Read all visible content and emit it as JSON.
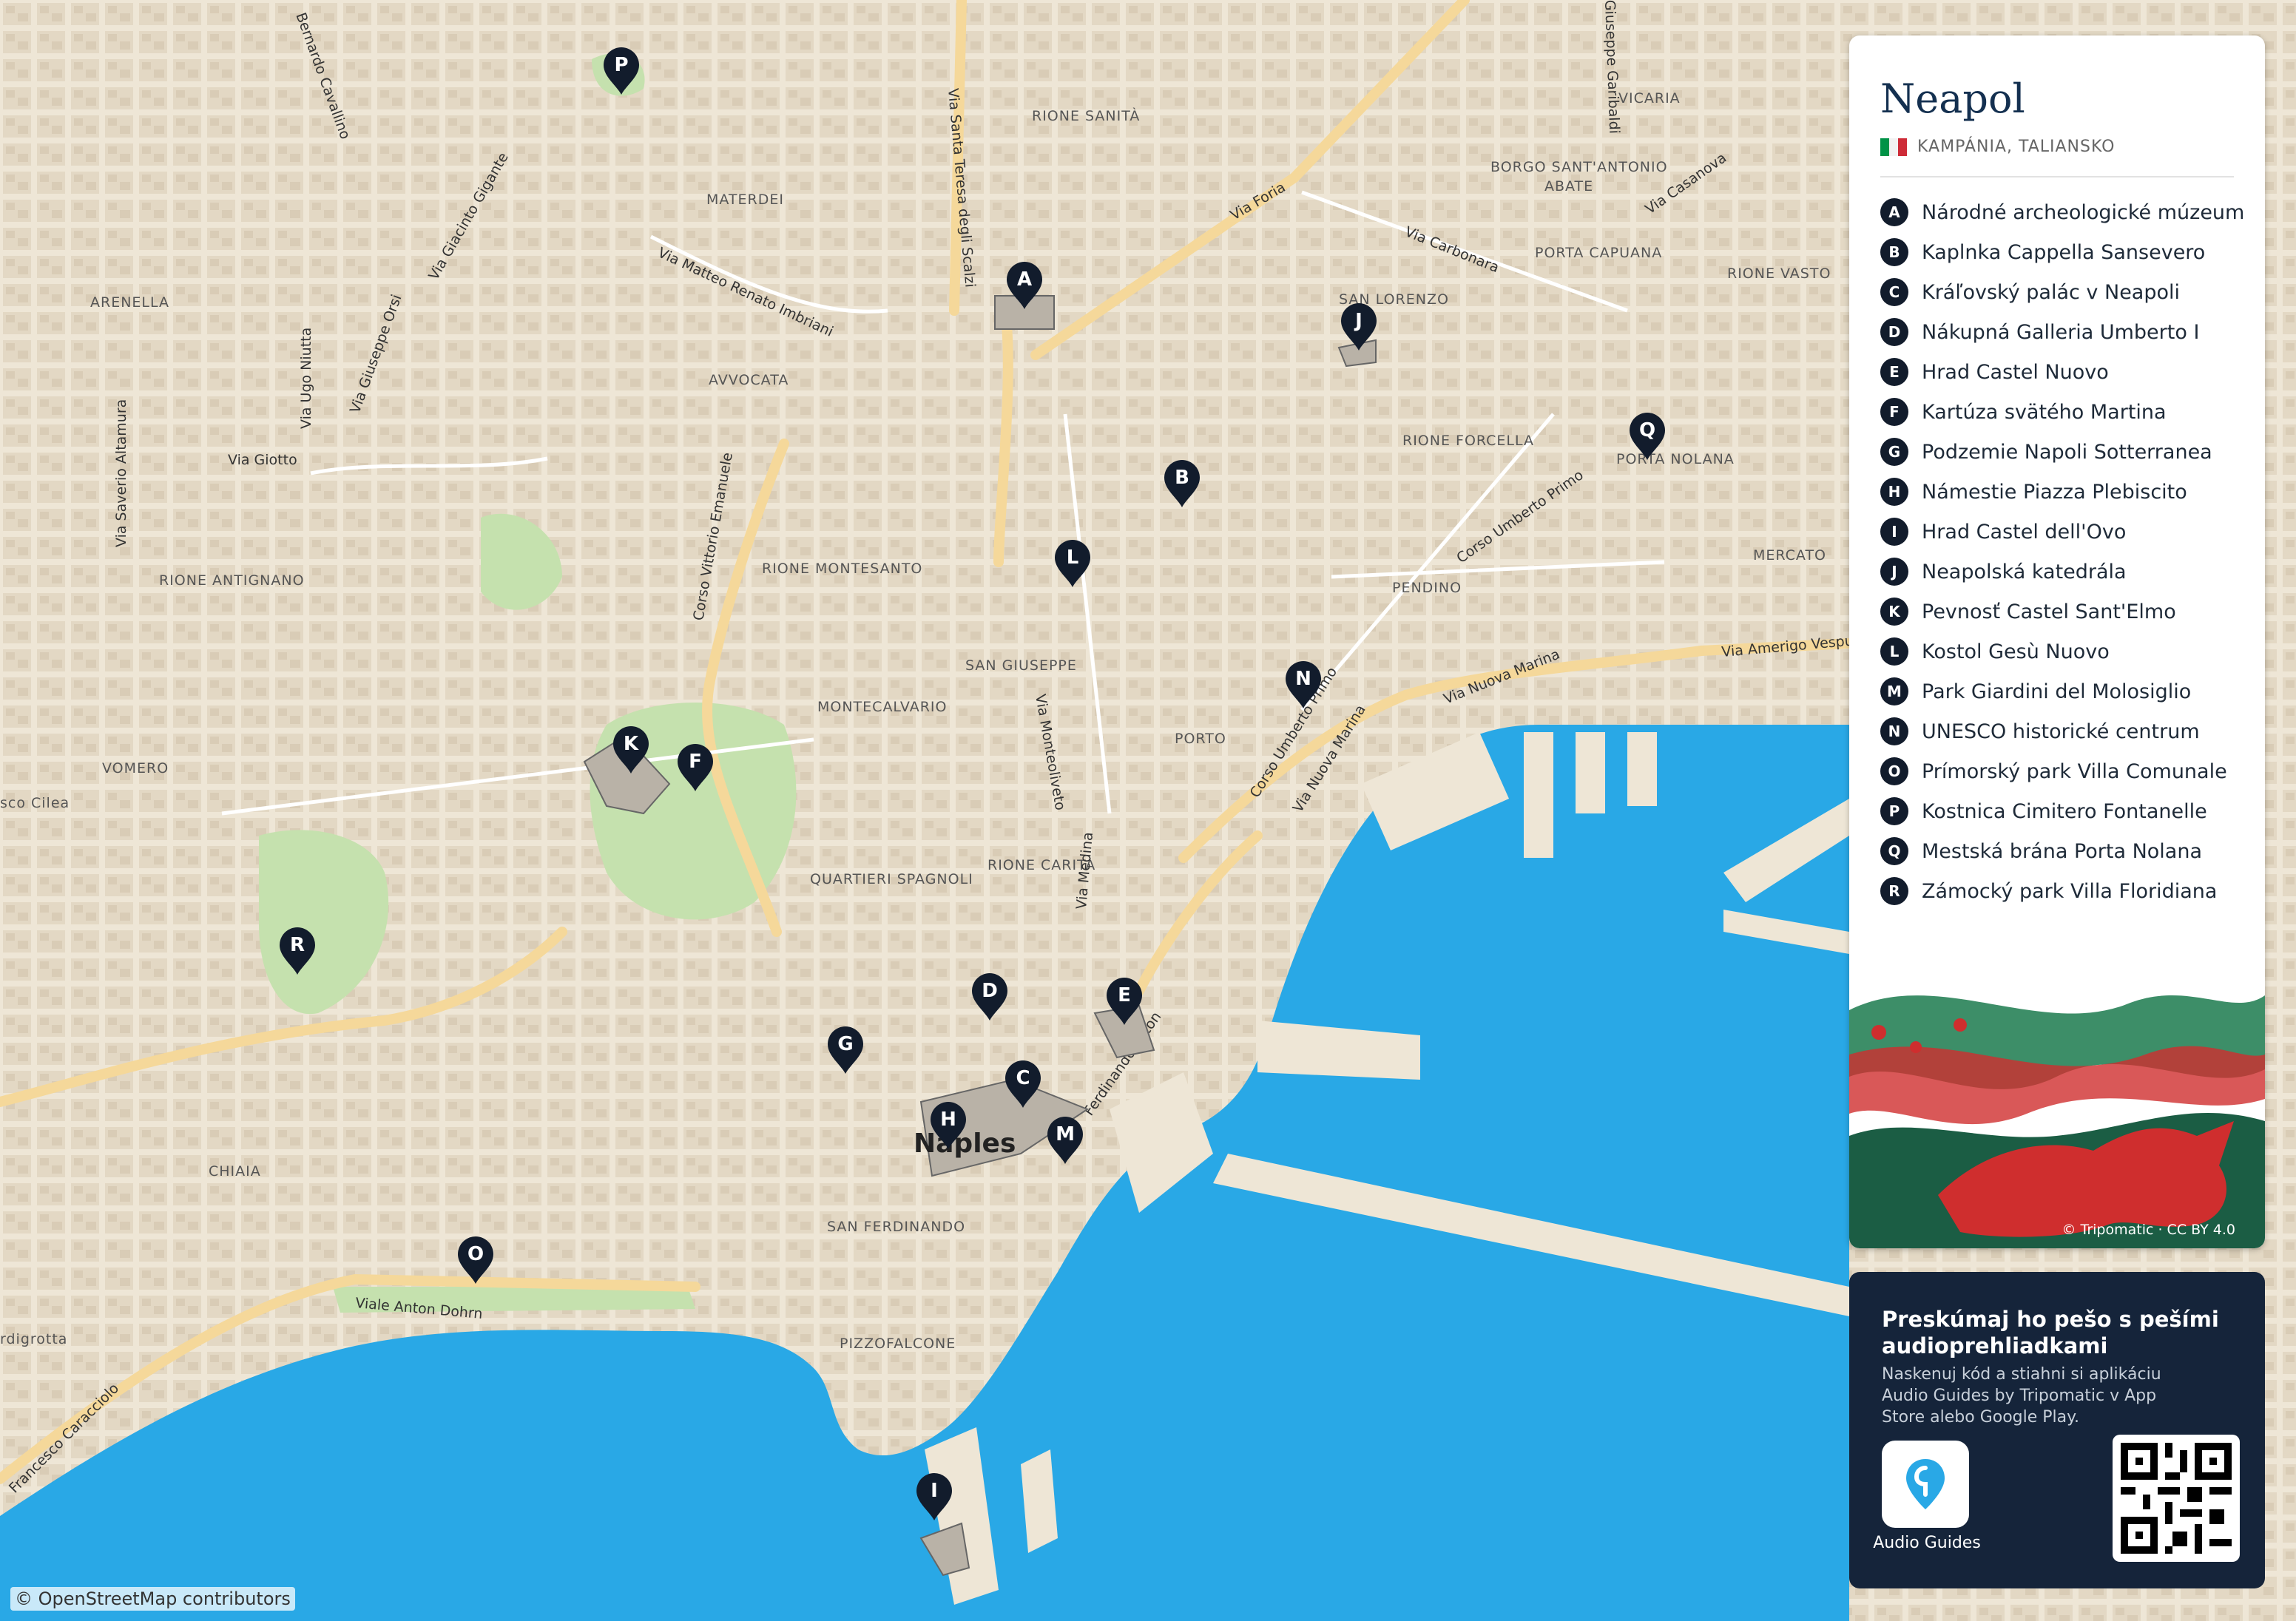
{
  "map": {
    "streets": [
      "Bernardo Cavallino",
      "Via Giacinto Gigante",
      "Via Ugo Niutta",
      "Via Giuseppe Orsi",
      "Via Saverio Altamura",
      "Via Giotto",
      "Via Matteo Renato Imbriani",
      "Via Santa Teresa degli Scalzi",
      "Corso Vittorio Emanuele",
      "Via Foria",
      "Via Carbonara",
      "Via Casanova",
      "Giuseppe Garibaldi",
      "Corso Umberto Primo",
      "Via Amerigo Vespucci",
      "Via Nuova Marina",
      "Via Monteoliveto",
      "Via Medina",
      "Ferdinando Acton",
      "Viale Anton Dohrn",
      "Francesco Caracciolo",
      "Corso Umberto Primo",
      "Via Nuova Marina"
    ],
    "districts": [
      "RIONE SANITÀ",
      "MATERDEI",
      "VICARIA",
      "BORGO SANT'ANTONIO",
      "ABATE",
      "ARENELLA",
      "AVVOCATA",
      "PORTA CAPUANA",
      "RIONE VASTO",
      "SAN LORENZO",
      "RIONE FORCELLA",
      "PORTA NOLANA",
      "RIONE MONTESANTO",
      "RIONE ANTIGNANO",
      "MERCATO",
      "PENDINO",
      "SAN GIUSEPPE",
      "MONTECALVARIO",
      "PORTO",
      "VOMERO",
      "QUARTIERI SPAGNOLI",
      "RIONE CARITÀ",
      "CHIAIA",
      "SAN FERDINANDO",
      "PIZZOFALCONE"
    ],
    "city_label": "Naples",
    "partial_labels": [
      "sco Cilea",
      "rdigrotta"
    ],
    "markers": [
      "A",
      "B",
      "C",
      "D",
      "E",
      "F",
      "G",
      "H",
      "I",
      "J",
      "K",
      "L",
      "M",
      "N",
      "O",
      "P",
      "Q",
      "R"
    ],
    "attribution": "© OpenStreetMap contributors"
  },
  "panel": {
    "title": "Neapol",
    "subtitle": "KAMPÁNIA, TALIANSKO",
    "flag_colors": [
      "#009246",
      "#ffffff",
      "#ce2b37"
    ],
    "legend": [
      {
        "letter": "A",
        "label": "Národné archeologické múzeum"
      },
      {
        "letter": "B",
        "label": "Kaplnka Cappella Sansevero"
      },
      {
        "letter": "C",
        "label": "Kráľovský palác v Neapoli"
      },
      {
        "letter": "D",
        "label": "Nákupná Galleria Umberto I"
      },
      {
        "letter": "E",
        "label": "Hrad Castel Nuovo"
      },
      {
        "letter": "F",
        "label": "Kartúza svätého Martina"
      },
      {
        "letter": "G",
        "label": "Podzemie Napoli Sotterranea"
      },
      {
        "letter": "H",
        "label": "Námestie Piazza Plebiscito"
      },
      {
        "letter": "I",
        "label": "Hrad Castel dell'Ovo"
      },
      {
        "letter": "J",
        "label": "Neapolská katedrála"
      },
      {
        "letter": "K",
        "label": "Pevnosť Castel Sant'Elmo"
      },
      {
        "letter": "L",
        "label": "Kostol Gesù Nuovo"
      },
      {
        "letter": "M",
        "label": "Park Giardini del Molosiglio"
      },
      {
        "letter": "N",
        "label": "UNESCO historické centrum"
      },
      {
        "letter": "O",
        "label": "Prímorský park Villa Comunale"
      },
      {
        "letter": "P",
        "label": "Kostnica Cimitero Fontanelle"
      },
      {
        "letter": "Q",
        "label": "Mestská brána Porta Nolana"
      },
      {
        "letter": "R",
        "label": "Zámocký park Villa Floridiana"
      }
    ],
    "art_credit": "© Tripomatic · CC BY 4.0"
  },
  "promo": {
    "title": "Preskúmaj ho pešo s pešími audioprehliadkami",
    "text": "Naskenuj kód a stiahni si aplikáciu Audio Guides by Tripomatic v App Store alebo Google Play.",
    "app_label": "Audio Guides"
  },
  "colors": {
    "sea": "#29a8e6",
    "land": "#eee6d6",
    "park": "#c9e4b4",
    "road_major": "#f5d89a",
    "marker": "#121c2c",
    "panel_dark": "#15243a"
  }
}
